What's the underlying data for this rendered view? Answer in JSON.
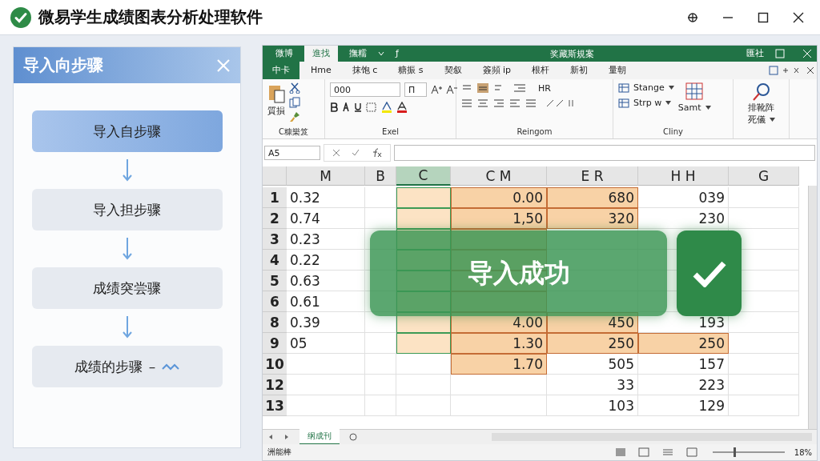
{
  "window": {
    "title": "微易学生成绩图表分析处理软件"
  },
  "wizard": {
    "title": "导入向步骤",
    "steps": [
      {
        "label": "导入自步骤",
        "selected": true
      },
      {
        "label": "导入担步骤",
        "selected": false
      },
      {
        "label": "成绩突尝骤",
        "selected": false
      },
      {
        "label": "成绩的步骤",
        "selected": false,
        "suffix": "–"
      }
    ]
  },
  "sheet": {
    "title": "奖藏斯規案",
    "account": "匯社",
    "function_mark": "ƒ",
    "top_tabs": [
      {
        "label": "微博",
        "selected": false
      },
      {
        "label": "進找",
        "selected": true
      },
      {
        "label": "撫糯",
        "selected": false
      }
    ],
    "ribbon_tabs": [
      {
        "label": "中卡",
        "kind": "file"
      },
      {
        "label": "Hme",
        "kind": "tab"
      },
      {
        "label": "抹饱 c",
        "kind": "tab"
      },
      {
        "label": "糖振 s",
        "kind": "tab"
      },
      {
        "label": "契叙",
        "kind": "tab"
      },
      {
        "label": "簽頻 ip",
        "kind": "tab"
      },
      {
        "label": "根杆",
        "kind": "tab"
      },
      {
        "label": "新初",
        "kind": "tab"
      },
      {
        "label": "量朝",
        "kind": "tab"
      }
    ],
    "ribbon": {
      "paste_label": "質損",
      "clipboard_label": "C糠樂笈",
      "font_name": "000",
      "font_size": "Π",
      "font_label": "Exel",
      "align_label": "Reingom",
      "wrap": "HR",
      "styles": [
        "Stange",
        "Strp w"
      ],
      "sum": "Samt",
      "styles_label": "Cliny",
      "sort": [
        "排靴阵",
        "死儀"
      ]
    },
    "name_box": "A5",
    "columns": [
      {
        "label": "M",
        "selected": false
      },
      {
        "label": "B",
        "selected": false
      },
      {
        "label": "C",
        "selected": true
      },
      {
        "label": "C   M",
        "selected": false
      },
      {
        "label": "E   R",
        "selected": false
      },
      {
        "label": "H   H",
        "selected": false
      },
      {
        "label": "G",
        "selected": false
      }
    ],
    "rows": [
      {
        "label": "1",
        "cells": [
          {
            "text": "0.32",
            "hl": false
          },
          {
            "hl": false
          },
          {
            "hl": true
          },
          {
            "text": "0.00",
            "hl": true
          },
          {
            "text": "680",
            "hl": true
          },
          {
            "text": "039",
            "hl": false
          },
          {
            "hl": false
          }
        ]
      },
      {
        "label": "2",
        "cells": [
          {
            "text": "0.74",
            "hl": false
          },
          {
            "hl": false
          },
          {
            "hl": true
          },
          {
            "text": "1,50",
            "hl": true
          },
          {
            "text": "320",
            "hl": true
          },
          {
            "text": "230",
            "hl": false
          },
          {
            "hl": false
          }
        ]
      },
      {
        "label": "3",
        "cells": [
          {
            "text": "0.23",
            "hl": false
          },
          {
            "hl": false
          },
          {
            "hl": true
          },
          {
            "hl": true
          },
          {
            "hl": false
          },
          {
            "hl": false
          },
          {
            "hl": false
          }
        ]
      },
      {
        "label": "4",
        "cells": [
          {
            "text": "0.22",
            "hl": false
          },
          {
            "hl": false
          },
          {
            "hl": true
          },
          {
            "hl": true
          },
          {
            "hl": false
          },
          {
            "hl": false
          },
          {
            "hl": false
          }
        ]
      },
      {
        "label": "5",
        "cells": [
          {
            "text": "0.63",
            "hl": false
          },
          {
            "hl": false
          },
          {
            "hl": true
          },
          {
            "hl": true
          },
          {
            "hl": false
          },
          {
            "hl": false
          },
          {
            "hl": false
          }
        ]
      },
      {
        "label": "6",
        "cells": [
          {
            "text": "0.61",
            "hl": false
          },
          {
            "hl": false
          },
          {
            "hl": true
          },
          {
            "hl": true
          },
          {
            "hl": false
          },
          {
            "hl": false
          },
          {
            "hl": false
          }
        ]
      },
      {
        "label": "8",
        "cells": [
          {
            "text": "0.39",
            "hl": false
          },
          {
            "hl": false
          },
          {
            "hl": true
          },
          {
            "text": "4.00",
            "hl": true
          },
          {
            "text": "450",
            "hl": true
          },
          {
            "text": "193",
            "hl": false
          },
          {
            "hl": false
          }
        ]
      },
      {
        "label": "9",
        "cells": [
          {
            "text": "05",
            "hl": false
          },
          {
            "hl": false
          },
          {
            "hl": true
          },
          {
            "text": "1.30",
            "hl": true
          },
          {
            "text": "250",
            "hl": true
          },
          {
            "text": "250",
            "hl": true
          },
          {
            "hl": false
          }
        ]
      },
      {
        "label": "10",
        "cells": [
          {
            "hl": false
          },
          {
            "hl": false
          },
          {
            "hl": false
          },
          {
            "text": "1.70",
            "hl": true
          },
          {
            "text": "505",
            "hl": false
          },
          {
            "text": "157",
            "hl": false
          },
          {
            "hl": false
          }
        ]
      },
      {
        "label": "12",
        "cells": [
          {
            "hl": false
          },
          {
            "hl": false
          },
          {
            "hl": false
          },
          {
            "hl": false
          },
          {
            "text": "33",
            "hl": false
          },
          {
            "text": "223",
            "hl": false
          },
          {
            "hl": false
          }
        ]
      },
      {
        "label": "13",
        "cells": [
          {
            "hl": false
          },
          {
            "hl": false
          },
          {
            "hl": false
          },
          {
            "hl": false
          },
          {
            "text": "103",
            "hl": false
          },
          {
            "text": "129",
            "hl": false
          },
          {
            "hl": false
          }
        ]
      }
    ],
    "sheet_tabs": [
      {
        "label": "纲成刊",
        "selected": true
      }
    ],
    "status": "洲能棒",
    "zoom": {
      "level": 0.3,
      "reading": "18%"
    }
  },
  "toast": {
    "message": "导入成功"
  }
}
